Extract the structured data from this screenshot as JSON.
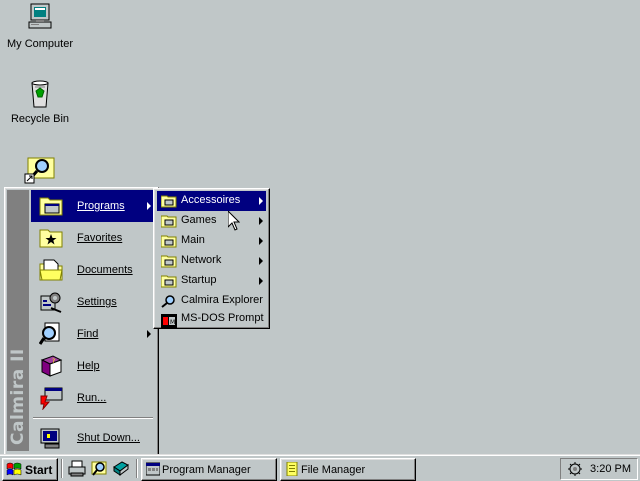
{
  "desktop": {
    "icons": [
      {
        "label": "My Computer"
      },
      {
        "label": "Recycle Bin"
      },
      {
        "label": ""
      }
    ]
  },
  "start_menu": {
    "banner": "Calmira II",
    "items": [
      {
        "label": "Programs",
        "has_submenu": true,
        "active": true
      },
      {
        "label": "Favorites"
      },
      {
        "label": "Documents"
      },
      {
        "label": "Settings"
      },
      {
        "label": "Find",
        "has_submenu": true
      },
      {
        "label": "Help"
      },
      {
        "label": "Run..."
      },
      {
        "label": "Shut Down..."
      }
    ]
  },
  "programs_submenu": {
    "items": [
      {
        "label": "Accessoires",
        "has_submenu": true,
        "active": true
      },
      {
        "label": "Games",
        "has_submenu": true
      },
      {
        "label": "Main",
        "has_submenu": true
      },
      {
        "label": "Network",
        "has_submenu": true
      },
      {
        "label": "Startup",
        "has_submenu": true
      },
      {
        "label": "Calmira Explorer"
      },
      {
        "label": "MS-DOS Prompt"
      }
    ]
  },
  "taskbar": {
    "start_label": "Start",
    "tasks": [
      {
        "label": "Program Manager"
      },
      {
        "label": "File Manager"
      }
    ],
    "clock": "3:20 PM"
  },
  "colors": {
    "desktop": "#c0c7c8",
    "highlight": "#000080",
    "banner": "#808080"
  }
}
